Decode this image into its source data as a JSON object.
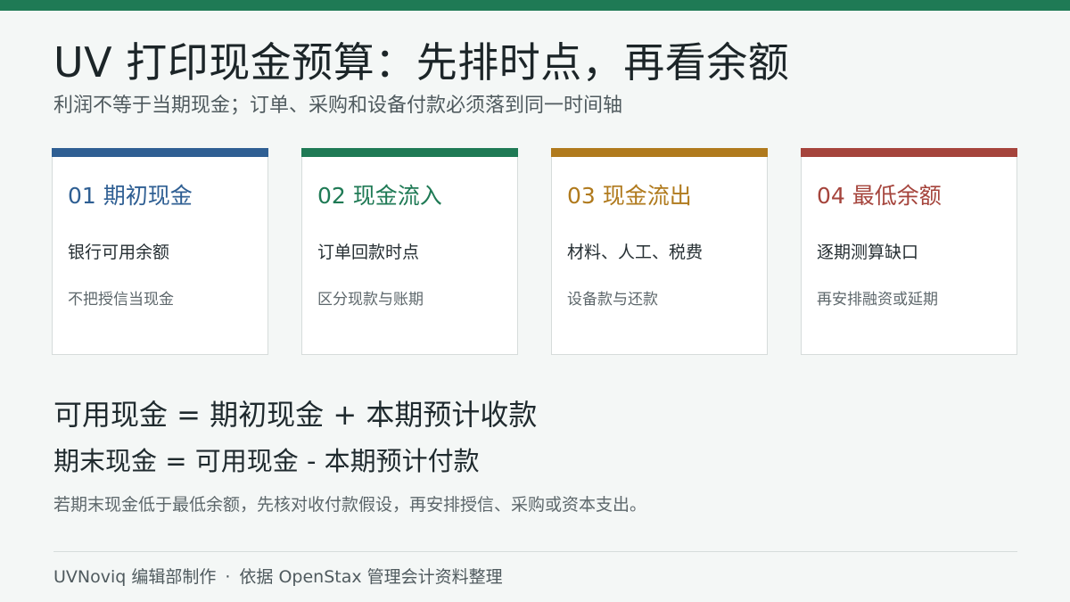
{
  "header": {
    "title": "UV 打印现金预算：先排时点，再看余额",
    "subtitle": "利润不等于当期现金；订单、采购和设备付款必须落到同一时间轴"
  },
  "cards": [
    {
      "title": "01 期初现金",
      "main": "银行可用余额",
      "note": "不把授信当现金",
      "color": "#2f5f93"
    },
    {
      "title": "02 现金流入",
      "main": "订单回款时点",
      "note": "区分现款与账期",
      "color": "#1f7a55"
    },
    {
      "title": "03 现金流出",
      "main": "材料、人工、税费",
      "note": "设备款与还款",
      "color": "#b07a1d"
    },
    {
      "title": "04 最低余额",
      "main": "逐期测算缺口",
      "note": "再安排融资或延期",
      "color": "#a5443c"
    }
  ],
  "formulas": {
    "line1": "可用现金 = 期初现金 + 本期预计收款",
    "line2": "期末现金 = 可用现金 - 本期预计付款"
  },
  "note": "若期末现金低于最低余额，先核对收付款假设，再安排授信、采购或资本支出。",
  "footer": {
    "left": "UVNoviq 编辑部制作",
    "separator": "·",
    "right": "依据 OpenStax 管理会计资料整理"
  },
  "colors": {
    "topbar": "#1f7a55"
  }
}
